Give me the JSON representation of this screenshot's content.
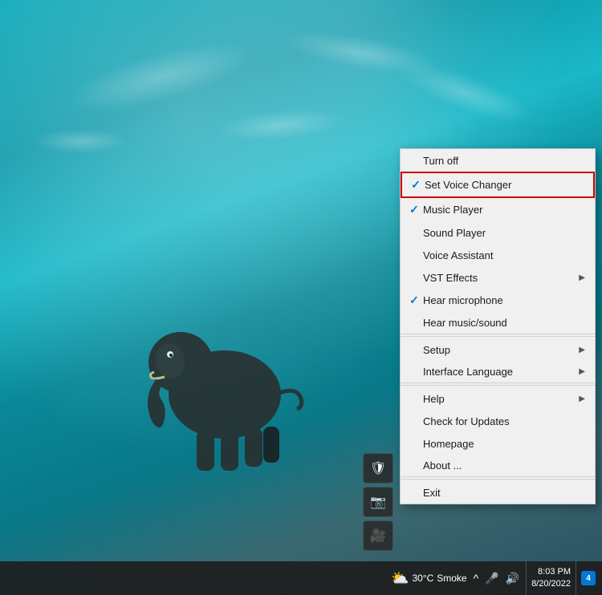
{
  "desktop": {
    "bg_description": "Underwater elephant scene"
  },
  "context_menu": {
    "items": [
      {
        "id": "turn-off",
        "label": "Turn off",
        "check": "",
        "has_arrow": false,
        "separator_after": false,
        "highlighted": false
      },
      {
        "id": "set-voice-changer",
        "label": "Set Voice Changer",
        "check": "✓",
        "has_arrow": false,
        "separator_after": false,
        "highlighted": true
      },
      {
        "id": "music-player",
        "label": "Music Player",
        "check": "✓",
        "has_arrow": false,
        "separator_after": false,
        "highlighted": false
      },
      {
        "id": "sound-player",
        "label": "Sound Player",
        "check": "",
        "has_arrow": false,
        "separator_after": false,
        "highlighted": false
      },
      {
        "id": "voice-assistant",
        "label": "Voice Assistant",
        "check": "",
        "has_arrow": false,
        "separator_after": false,
        "highlighted": false
      },
      {
        "id": "vst-effects",
        "label": "VST Effects",
        "check": "",
        "has_arrow": true,
        "separator_after": false,
        "highlighted": false
      },
      {
        "id": "hear-microphone",
        "label": "Hear microphone",
        "check": "✓",
        "has_arrow": false,
        "separator_after": false,
        "highlighted": false
      },
      {
        "id": "hear-music",
        "label": "Hear music/sound",
        "check": "",
        "has_arrow": false,
        "separator_after": true,
        "highlighted": false
      },
      {
        "id": "setup",
        "label": "Setup",
        "check": "",
        "has_arrow": true,
        "separator_after": false,
        "highlighted": false
      },
      {
        "id": "interface-language",
        "label": "Interface Language",
        "check": "",
        "has_arrow": true,
        "separator_after": true,
        "highlighted": false
      },
      {
        "id": "help",
        "label": "Help",
        "check": "",
        "has_arrow": true,
        "separator_after": false,
        "highlighted": false
      },
      {
        "id": "check-updates",
        "label": "Check for Updates",
        "check": "",
        "has_arrow": false,
        "separator_after": false,
        "highlighted": false
      },
      {
        "id": "homepage",
        "label": "Homepage",
        "check": "",
        "has_arrow": false,
        "separator_after": false,
        "highlighted": false
      },
      {
        "id": "about",
        "label": "About ...",
        "check": "",
        "has_arrow": false,
        "separator_after": true,
        "highlighted": false
      },
      {
        "id": "exit",
        "label": "Exit",
        "check": "",
        "has_arrow": false,
        "separator_after": false,
        "highlighted": false
      }
    ]
  },
  "taskbar": {
    "weather_icon": "⛅",
    "temperature": "30°C",
    "weather_condition": "Smoke",
    "time": "8:03 PM",
    "date": "8/20/2022",
    "notification_count": "4",
    "chevron_label": "^",
    "mic_icon": "🎤",
    "volume_icon": "🔊"
  },
  "sidebar_icons": [
    {
      "id": "icon1",
      "symbol": "🛡"
    },
    {
      "id": "icon2",
      "symbol": "📷"
    },
    {
      "id": "icon3",
      "symbol": "🎥"
    }
  ]
}
